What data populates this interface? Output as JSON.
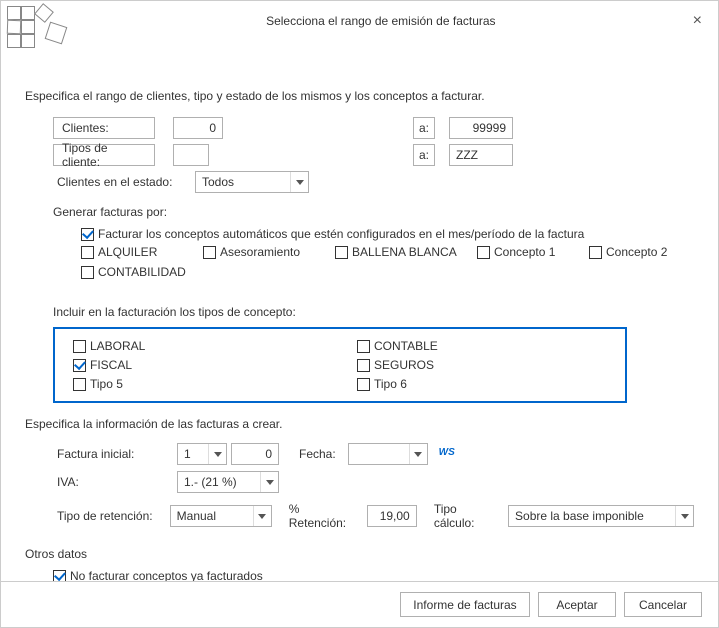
{
  "window": {
    "title": "Selecciona el rango de emisión de facturas",
    "close": "×"
  },
  "description": "Especifica el rango de clientes, tipo y estado de los mismos y los conceptos a facturar.",
  "clients": {
    "label": "Clientes:",
    "from": "0",
    "to_label": "a:",
    "to": "99999"
  },
  "client_types": {
    "label": "Tipos de cliente:",
    "from": "",
    "to_label": "a:",
    "to": "ZZZ"
  },
  "client_state": {
    "label": "Clientes en el estado:",
    "value": "Todos"
  },
  "generate": {
    "label": "Generar facturas por:",
    "auto_label": "Facturar los conceptos automáticos que estén configurados en el mes/período de la factura",
    "auto_checked": true,
    "concepts": [
      {
        "label": "ALQUILER",
        "checked": false
      },
      {
        "label": "Asesoramiento",
        "checked": false
      },
      {
        "label": "BALLENA BLANCA",
        "checked": false
      },
      {
        "label": "Concepto 1",
        "checked": false
      },
      {
        "label": "Concepto 2",
        "checked": false
      },
      {
        "label": "CONTABILIDAD",
        "checked": false
      }
    ]
  },
  "include": {
    "label": "Incluir en la facturación los tipos de concepto:",
    "items": [
      {
        "label": "LABORAL",
        "checked": false
      },
      {
        "label": "CONTABLE",
        "checked": false
      },
      {
        "label": "FISCAL",
        "checked": true
      },
      {
        "label": "SEGUROS",
        "checked": false
      },
      {
        "label": "Tipo 5",
        "checked": false
      },
      {
        "label": "Tipo 6",
        "checked": false
      }
    ]
  },
  "invoice_info": {
    "heading": "Especifica la información de las facturas a crear.",
    "initial_label": "Factura inicial:",
    "initial_series": "1",
    "initial_number": "0",
    "date_label": "Fecha:",
    "date_value": "",
    "iva_label": "IVA:",
    "iva_value": "1.- (21 %)",
    "retention_type_label": "Tipo de retención:",
    "retention_type_value": "Manual",
    "retention_pct_label": "% Retención:",
    "retention_pct_value": "19,00",
    "calc_type_label": "Tipo cálculo:",
    "calc_type_value": "Sobre la base imponible"
  },
  "other": {
    "heading": "Otros datos",
    "no_refacturar_label": "No facturar conceptos ya facturados",
    "no_refacturar_checked": true
  },
  "footer": {
    "report": "Informe de facturas",
    "accept": "Aceptar",
    "cancel": "Cancelar"
  }
}
